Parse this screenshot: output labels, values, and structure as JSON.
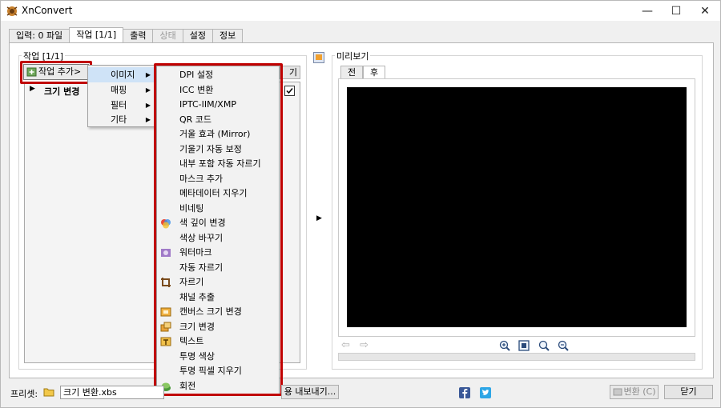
{
  "window": {
    "title": "XnConvert"
  },
  "tabs": [
    {
      "label": "입력: 0 파일",
      "state": "normal"
    },
    {
      "label": "작업 [1/1]",
      "state": "active"
    },
    {
      "label": "출력",
      "state": "normal"
    },
    {
      "label": "상태",
      "state": "disabled"
    },
    {
      "label": "설정",
      "state": "normal"
    },
    {
      "label": "정보",
      "state": "normal"
    }
  ],
  "tasks": {
    "group_label": "작업 [1/1]",
    "add_button": "작업 추가>",
    "partial_button_label": "기",
    "rows": [
      {
        "label": "크기 변경",
        "checked": true
      }
    ]
  },
  "submenu": {
    "items": [
      {
        "label": "이미지",
        "highlighted": true
      },
      {
        "label": "매핑",
        "highlighted": false
      },
      {
        "label": "필터",
        "highlighted": false
      },
      {
        "label": "기타",
        "highlighted": false
      }
    ]
  },
  "image_menu": {
    "items": [
      {
        "label": "DPI 설정",
        "icon": ""
      },
      {
        "label": "ICC 변환",
        "icon": ""
      },
      {
        "label": "IPTC-IIM/XMP",
        "icon": ""
      },
      {
        "label": "QR 코드",
        "icon": ""
      },
      {
        "label": "거울 효과 (Mirror)",
        "icon": ""
      },
      {
        "label": "기울기 자동 보정",
        "icon": ""
      },
      {
        "label": "내부 포함 자동 자르기",
        "icon": ""
      },
      {
        "label": "마스크 추가",
        "icon": ""
      },
      {
        "label": "메타데이터 지우기",
        "icon": ""
      },
      {
        "label": "비네팅",
        "icon": ""
      },
      {
        "label": "색 깊이 변경",
        "icon": "color-depth-icon"
      },
      {
        "label": "색상 바꾸기",
        "icon": ""
      },
      {
        "label": "워터마크",
        "icon": "watermark-icon"
      },
      {
        "label": "자동 자르기",
        "icon": ""
      },
      {
        "label": "자르기",
        "icon": "crop-icon"
      },
      {
        "label": "채널 추출",
        "icon": ""
      },
      {
        "label": "캔버스 크기 변경",
        "icon": "canvas-size-icon"
      },
      {
        "label": "크기 변경",
        "icon": "resize-icon"
      },
      {
        "label": "텍스트",
        "icon": "text-icon"
      },
      {
        "label": "투명 색상",
        "icon": ""
      },
      {
        "label": "투명 픽셀 지우기",
        "icon": ""
      },
      {
        "label": "회전",
        "icon": "rotate-icon"
      }
    ]
  },
  "preview": {
    "label": "미리보기",
    "tabs": [
      {
        "label": "전"
      },
      {
        "label": "후",
        "active": true
      }
    ]
  },
  "bottom": {
    "preset_label": "프리셋:",
    "preset_value": "크기 변환.xbs",
    "export_button": "용 내보내기...",
    "convert_button": "변환 (C)",
    "close_button": "닫기"
  },
  "colors": {
    "highlight_box": "#c00000",
    "menu_highlight": "#cfe3f7",
    "preview_bg": "#000000"
  }
}
